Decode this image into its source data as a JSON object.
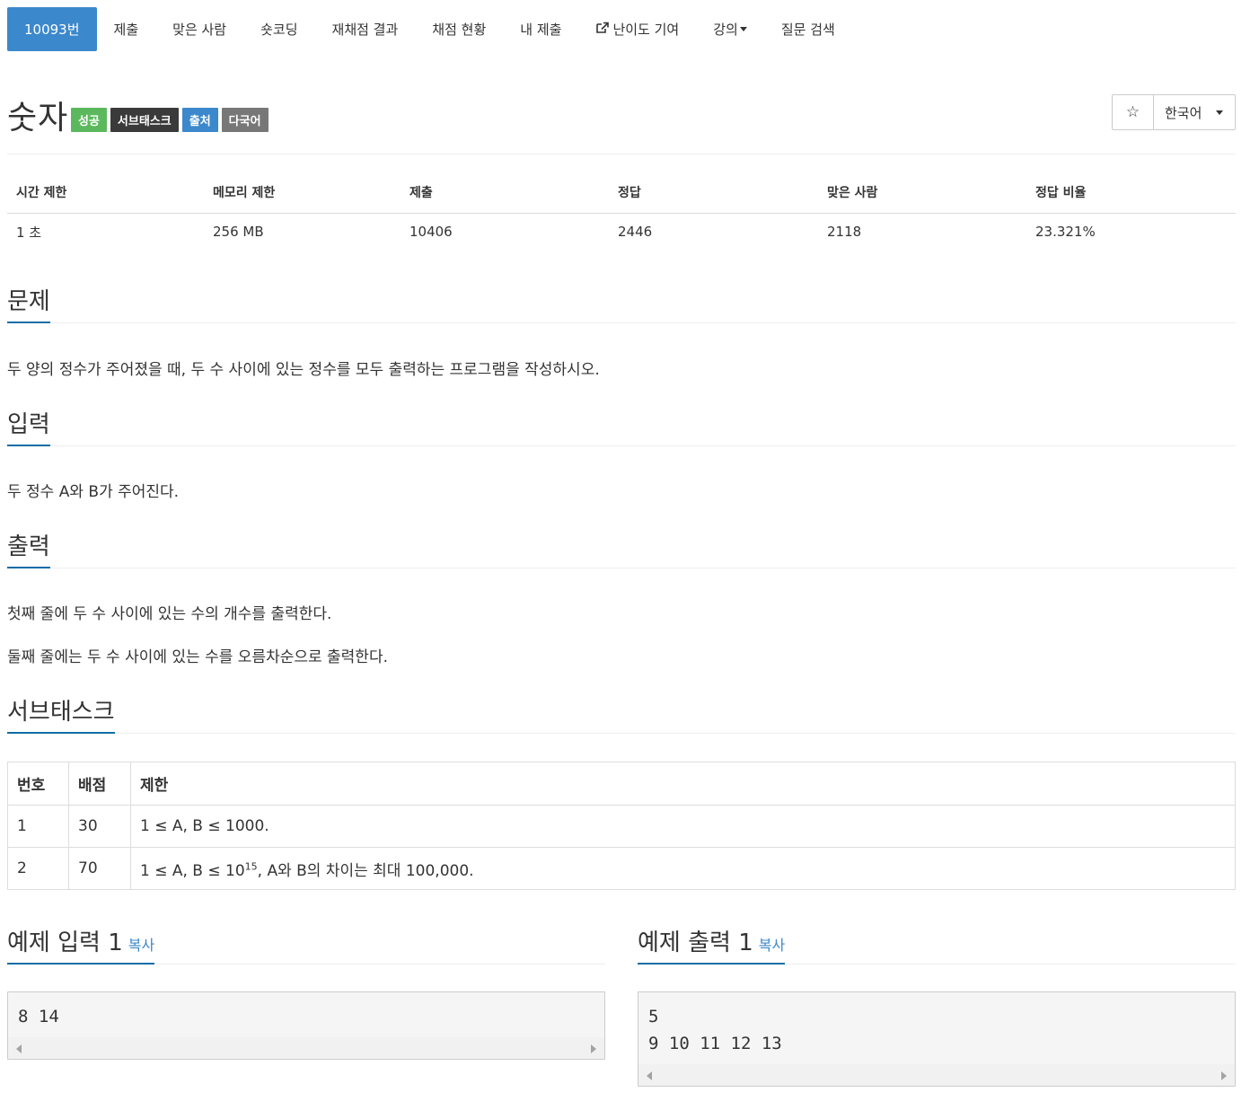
{
  "nav": {
    "tabs": [
      {
        "label": "10093번",
        "active": true
      },
      {
        "label": "제출"
      },
      {
        "label": "맞은 사람"
      },
      {
        "label": "숏코딩"
      },
      {
        "label": "재채점 결과"
      },
      {
        "label": "채점 현황"
      },
      {
        "label": "내 제출"
      },
      {
        "label": "난이도 기여",
        "icon": "external-link-icon"
      },
      {
        "label": "강의",
        "icon": "caret-down-icon"
      },
      {
        "label": "질문 검색"
      }
    ]
  },
  "problem": {
    "title": "숫자",
    "labels": [
      {
        "text": "성공",
        "color": "#5cb85c"
      },
      {
        "text": "서브태스크",
        "color": "#3a3a3a"
      },
      {
        "text": "출처",
        "color": "#3c88cc"
      },
      {
        "text": "다국어",
        "color": "#777777"
      }
    ],
    "star_icon": "star-outline-icon",
    "language": "한국어"
  },
  "info": {
    "headers": [
      "시간 제한",
      "메모리 제한",
      "제출",
      "정답",
      "맞은 사람",
      "정답 비율"
    ],
    "values": [
      "1 초",
      "256 MB",
      "10406",
      "2446",
      "2118",
      "23.321%"
    ]
  },
  "sections": {
    "problem_heading": "문제",
    "problem_text": "두 양의 정수가 주어졌을 때, 두 수 사이에 있는 정수를 모두 출력하는 프로그램을 작성하시오.",
    "input_heading": "입력",
    "input_text": "두 정수 A와 B가 주어진다.",
    "output_heading": "출력",
    "output_text_1": "첫째 줄에 두 수 사이에 있는 수의 개수를 출력한다.",
    "output_text_2": "둘째 줄에는 두 수 사이에 있는 수를 오름차순으로 출력한다.",
    "subtask_heading": "서브태스크"
  },
  "subtasks": {
    "headers": [
      "번호",
      "배점",
      "제한"
    ],
    "rows": [
      {
        "no": "1",
        "score": "30",
        "limit": "1 ≤ A, B ≤ 1000."
      },
      {
        "no": "2",
        "score": "70",
        "limit_pre": "1 ≤ A, B ≤ 10",
        "limit_sup": "15",
        "limit_post": ", A와 B의 차이는 최대 100,000."
      }
    ]
  },
  "samples": {
    "input_heading": "예제 입력 1",
    "output_heading": "예제 출력 1",
    "copy_label": "복사",
    "input_lines": [
      "8 14"
    ],
    "output_lines": [
      "5",
      "9 10 11 12 13"
    ]
  }
}
